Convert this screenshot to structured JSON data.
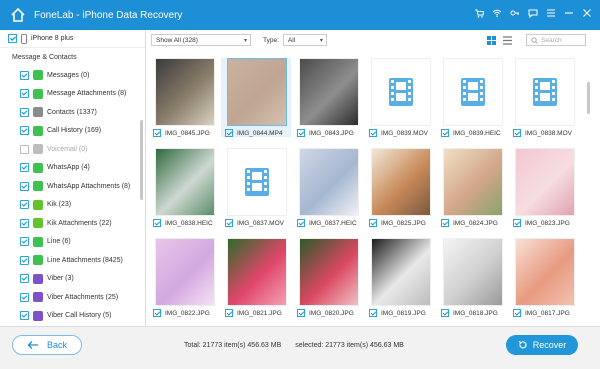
{
  "app": {
    "title": "FoneLab - iPhone Data Recovery"
  },
  "colors": {
    "accent": "#1d8fd6",
    "checkbox": "#2aa5d8",
    "recover_button": "#2196d9"
  },
  "titlebar_icons": [
    "cart-icon",
    "wifi-icon",
    "key-icon",
    "chat-icon",
    "menu-icon",
    "minimize-icon",
    "close-icon"
  ],
  "sidebar": {
    "device": "iPhone 8 plus",
    "section": "Message & Contacts",
    "items": [
      {
        "label": "Messages (0)",
        "checked": true,
        "icon": "messages-icon",
        "color": "#3dc24f"
      },
      {
        "label": "Message Attachments (8)",
        "checked": true,
        "icon": "message-attachment-icon",
        "color": "#3dc24f"
      },
      {
        "label": "Contacts (1337)",
        "checked": true,
        "icon": "contacts-icon",
        "color": "#8b8b8b"
      },
      {
        "label": "Call History (169)",
        "checked": true,
        "icon": "phone-icon",
        "color": "#3dc24f"
      },
      {
        "label": "Voicemail (0)",
        "checked": false,
        "icon": "voicemail-icon",
        "color": "#bdbdbd"
      },
      {
        "label": "WhatsApp (4)",
        "checked": true,
        "icon": "whatsapp-icon",
        "color": "#3dc24f"
      },
      {
        "label": "WhatsApp Attachments (8)",
        "checked": true,
        "icon": "whatsapp-attachment-icon",
        "color": "#3dc24f"
      },
      {
        "label": "Kik (23)",
        "checked": true,
        "icon": "kik-icon",
        "color": "#63c32f"
      },
      {
        "label": "Kik Attachments (22)",
        "checked": true,
        "icon": "kik-attachment-icon",
        "color": "#63c32f"
      },
      {
        "label": "Line (6)",
        "checked": true,
        "icon": "line-icon",
        "color": "#3dc24f"
      },
      {
        "label": "Line Attachments (8425)",
        "checked": true,
        "icon": "line-attachment-icon",
        "color": "#3dc24f"
      },
      {
        "label": "Viber (3)",
        "checked": true,
        "icon": "viber-icon",
        "color": "#7d52c7"
      },
      {
        "label": "Viber Attachments (25)",
        "checked": true,
        "icon": "viber-attachment-icon",
        "color": "#7d52c7"
      },
      {
        "label": "Viber Call History (5)",
        "checked": true,
        "icon": "viber-call-icon",
        "color": "#7d52c7"
      }
    ]
  },
  "toolbar": {
    "show_filter": "Show All (328)",
    "type_label": "Type:",
    "type_value": "All",
    "search_placeholder": "Search"
  },
  "grid": {
    "items": [
      {
        "name": "IMG_0845.JPG",
        "kind": "photo",
        "colors": [
          "#3b3b3b",
          "#8a7d6a",
          "#d9d2c2"
        ],
        "selected": false
      },
      {
        "name": "IMG_0844.MP4",
        "kind": "photo",
        "colors": [
          "#cbb2a0",
          "#bfa592",
          "#d6c1b1"
        ],
        "selected": true
      },
      {
        "name": "IMG_0843.JPG",
        "kind": "photo",
        "colors": [
          "#4b4b4b",
          "#8e8e8e",
          "#2c2c2c"
        ],
        "selected": false
      },
      {
        "name": "IMG_0839.MOV",
        "kind": "video",
        "selected": false
      },
      {
        "name": "IMG_0839.HEIC",
        "kind": "video",
        "selected": false
      },
      {
        "name": "IMG_0838.MOV",
        "kind": "video",
        "selected": false
      },
      {
        "name": "IMG_0838.HEIC",
        "kind": "photo",
        "colors": [
          "#2f6a3e",
          "#cfd8d2",
          "#5a8f69"
        ],
        "selected": false
      },
      {
        "name": "IMG_0837.MOV",
        "kind": "video",
        "selected": false
      },
      {
        "name": "IMG_0837.HEIC",
        "kind": "photo",
        "colors": [
          "#cfd7e6",
          "#a5b7d0",
          "#f0f2f6"
        ],
        "selected": false
      },
      {
        "name": "IMG_0825.JPG",
        "kind": "photo",
        "colors": [
          "#f2e7d8",
          "#c88a5a",
          "#7a5a3e"
        ],
        "selected": false
      },
      {
        "name": "IMG_0824.JPG",
        "kind": "photo",
        "colors": [
          "#efe0c5",
          "#d2a68a",
          "#8aa36a"
        ],
        "selected": false
      },
      {
        "name": "IMG_0823.JPG",
        "kind": "photo",
        "colors": [
          "#f3c7d0",
          "#f6dde2",
          "#e0a2b0"
        ],
        "selected": false
      },
      {
        "name": "IMG_0822.JPG",
        "kind": "photo",
        "colors": [
          "#e8c6ea",
          "#d3a8e0",
          "#f5e2f3"
        ],
        "selected": false
      },
      {
        "name": "IMG_0821.JPG",
        "kind": "photo",
        "colors": [
          "#2e6b2a",
          "#e0466a",
          "#f4a0b4"
        ],
        "selected": false
      },
      {
        "name": "IMG_0820.JPG",
        "kind": "photo",
        "colors": [
          "#2e5a2a",
          "#d8485f",
          "#f0c0c8"
        ],
        "selected": false
      },
      {
        "name": "IMG_0819.JPG",
        "kind": "photo",
        "colors": [
          "#1c1c1c",
          "#e8e8e8",
          "#bdbdbd"
        ],
        "selected": false
      },
      {
        "name": "IMG_0818.JPG",
        "kind": "photo",
        "colors": [
          "#f4f4f4",
          "#cfcfcf",
          "#9a9a9a"
        ],
        "selected": false
      },
      {
        "name": "IMG_0817.JPG",
        "kind": "photo",
        "colors": [
          "#f8e0d6",
          "#e89a80",
          "#f2c2b0"
        ],
        "selected": false
      }
    ]
  },
  "footer": {
    "back_label": "Back",
    "total": "Total: 21773 item(s) 456.63 MB",
    "selected": "selected: 21773 item(s) 456.63 MB",
    "recover_label": "Recover"
  }
}
